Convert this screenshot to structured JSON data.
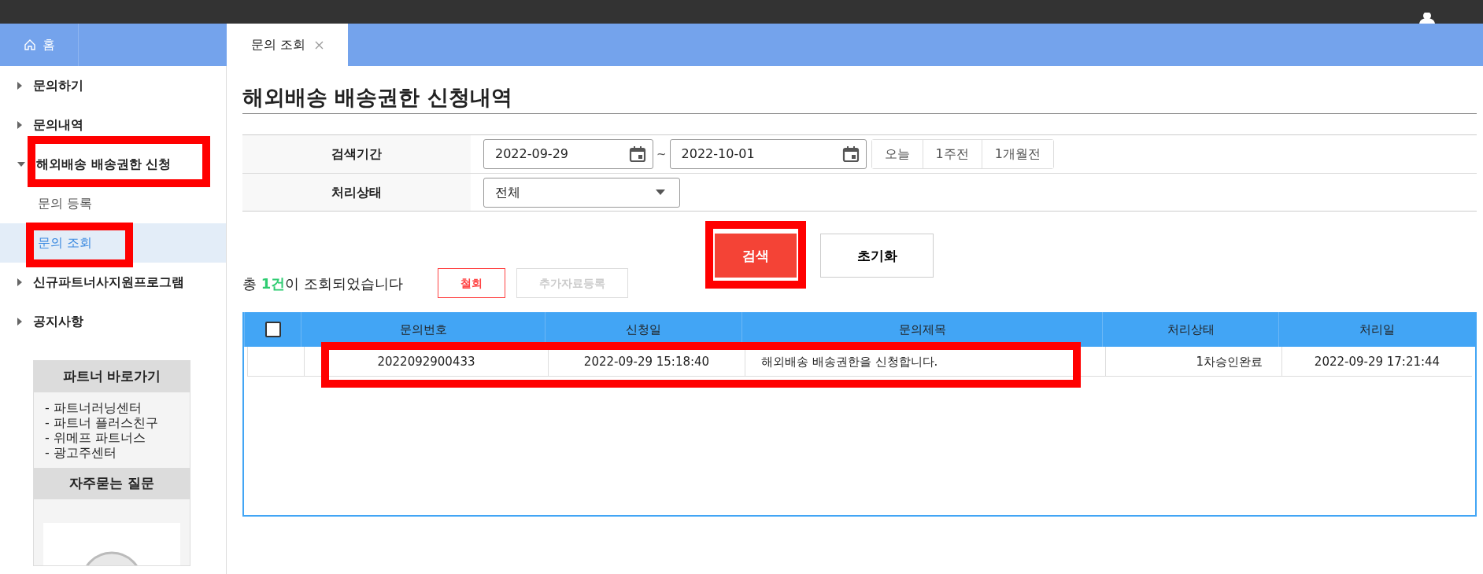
{
  "home_tab": {
    "label": "홈"
  },
  "tabs": [
    {
      "label": "문의 조회",
      "selected": true
    }
  ],
  "sidebar": {
    "items": [
      {
        "label": "문의하기",
        "expanded": false,
        "highlighted": false
      },
      {
        "label": "문의내역",
        "expanded": false,
        "highlighted": false
      },
      {
        "label": "해외배송 배송권한 신청",
        "expanded": true,
        "highlighted": true,
        "children": [
          {
            "label": "문의 등록",
            "selected": false,
            "highlighted": false
          },
          {
            "label": "문의 조회",
            "selected": true,
            "highlighted": true
          }
        ]
      },
      {
        "label": "신규파트너사지원프로그램",
        "expanded": false,
        "highlighted": false
      },
      {
        "label": "공지사항",
        "expanded": false,
        "highlighted": false
      }
    ]
  },
  "partner_box": {
    "title": "파트너 바로가기",
    "links": [
      "- 파트너러닝센터",
      "- 파트너 플러스친구",
      "- 위메프 파트너스",
      "- 광고주센터"
    ],
    "faq_title": "자주묻는 질문"
  },
  "page_title": "해외배송 배송권한 신청내역",
  "search": {
    "period_label": "검색기간",
    "date_from": "2022-09-29",
    "separator": "~",
    "date_to": "2022-10-01",
    "quick_ranges": [
      "오늘",
      "1주전",
      "1개월전"
    ],
    "status_label": "처리상태",
    "status_value": "전체"
  },
  "buttons": [
    {
      "label": "검색",
      "kind": "primary",
      "highlighted": true
    },
    {
      "label": "초기화",
      "kind": "secondary",
      "highlighted": false
    }
  ],
  "result_text": "총 **1건**이 조회되었습니다",
  "actions": [
    {
      "label": "철회",
      "disabled": false
    },
    {
      "label": "추가자료등록",
      "disabled": true
    }
  ],
  "table": {
    "select_all": {
      "checked": false
    },
    "columns": [
      "문의번호",
      "신청일",
      "문의제목",
      "처리상태",
      "처리일"
    ],
    "rows": [
      {
        "highlighted": true,
        "cells": [
          "2022092900433",
          "2022-09-29 15:18:40",
          "해외배송 배송권한을 신청합니다.",
          "1차승인완료",
          "2022-09-29 17:21:44"
        ]
      }
    ]
  }
}
